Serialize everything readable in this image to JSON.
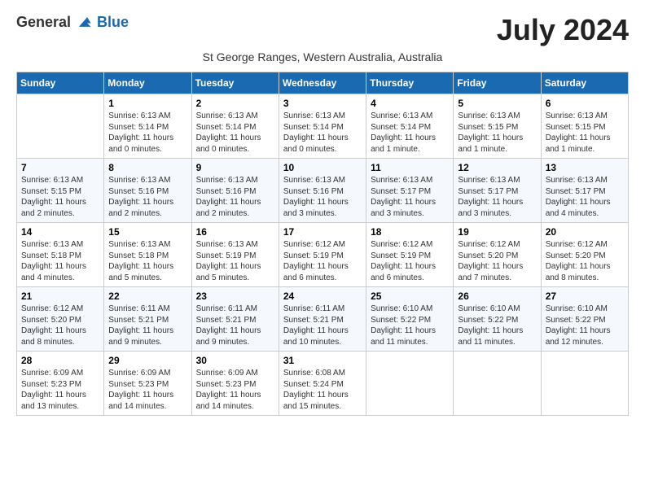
{
  "header": {
    "logo_general": "General",
    "logo_blue": "Blue",
    "month": "July 2024",
    "subtitle": "St George Ranges, Western Australia, Australia"
  },
  "days_of_week": [
    "Sunday",
    "Monday",
    "Tuesday",
    "Wednesday",
    "Thursday",
    "Friday",
    "Saturday"
  ],
  "weeks": [
    [
      {
        "day": "",
        "info": ""
      },
      {
        "day": "1",
        "info": "Sunrise: 6:13 AM\nSunset: 5:14 PM\nDaylight: 11 hours\nand 0 minutes."
      },
      {
        "day": "2",
        "info": "Sunrise: 6:13 AM\nSunset: 5:14 PM\nDaylight: 11 hours\nand 0 minutes."
      },
      {
        "day": "3",
        "info": "Sunrise: 6:13 AM\nSunset: 5:14 PM\nDaylight: 11 hours\nand 0 minutes."
      },
      {
        "day": "4",
        "info": "Sunrise: 6:13 AM\nSunset: 5:14 PM\nDaylight: 11 hours\nand 1 minute."
      },
      {
        "day": "5",
        "info": "Sunrise: 6:13 AM\nSunset: 5:15 PM\nDaylight: 11 hours\nand 1 minute."
      },
      {
        "day": "6",
        "info": "Sunrise: 6:13 AM\nSunset: 5:15 PM\nDaylight: 11 hours\nand 1 minute."
      }
    ],
    [
      {
        "day": "7",
        "info": "Sunrise: 6:13 AM\nSunset: 5:15 PM\nDaylight: 11 hours\nand 2 minutes."
      },
      {
        "day": "8",
        "info": "Sunrise: 6:13 AM\nSunset: 5:16 PM\nDaylight: 11 hours\nand 2 minutes."
      },
      {
        "day": "9",
        "info": "Sunrise: 6:13 AM\nSunset: 5:16 PM\nDaylight: 11 hours\nand 2 minutes."
      },
      {
        "day": "10",
        "info": "Sunrise: 6:13 AM\nSunset: 5:16 PM\nDaylight: 11 hours\nand 3 minutes."
      },
      {
        "day": "11",
        "info": "Sunrise: 6:13 AM\nSunset: 5:17 PM\nDaylight: 11 hours\nand 3 minutes."
      },
      {
        "day": "12",
        "info": "Sunrise: 6:13 AM\nSunset: 5:17 PM\nDaylight: 11 hours\nand 3 minutes."
      },
      {
        "day": "13",
        "info": "Sunrise: 6:13 AM\nSunset: 5:17 PM\nDaylight: 11 hours\nand 4 minutes."
      }
    ],
    [
      {
        "day": "14",
        "info": "Sunrise: 6:13 AM\nSunset: 5:18 PM\nDaylight: 11 hours\nand 4 minutes."
      },
      {
        "day": "15",
        "info": "Sunrise: 6:13 AM\nSunset: 5:18 PM\nDaylight: 11 hours\nand 5 minutes."
      },
      {
        "day": "16",
        "info": "Sunrise: 6:13 AM\nSunset: 5:19 PM\nDaylight: 11 hours\nand 5 minutes."
      },
      {
        "day": "17",
        "info": "Sunrise: 6:12 AM\nSunset: 5:19 PM\nDaylight: 11 hours\nand 6 minutes."
      },
      {
        "day": "18",
        "info": "Sunrise: 6:12 AM\nSunset: 5:19 PM\nDaylight: 11 hours\nand 6 minutes."
      },
      {
        "day": "19",
        "info": "Sunrise: 6:12 AM\nSunset: 5:20 PM\nDaylight: 11 hours\nand 7 minutes."
      },
      {
        "day": "20",
        "info": "Sunrise: 6:12 AM\nSunset: 5:20 PM\nDaylight: 11 hours\nand 8 minutes."
      }
    ],
    [
      {
        "day": "21",
        "info": "Sunrise: 6:12 AM\nSunset: 5:20 PM\nDaylight: 11 hours\nand 8 minutes."
      },
      {
        "day": "22",
        "info": "Sunrise: 6:11 AM\nSunset: 5:21 PM\nDaylight: 11 hours\nand 9 minutes."
      },
      {
        "day": "23",
        "info": "Sunrise: 6:11 AM\nSunset: 5:21 PM\nDaylight: 11 hours\nand 9 minutes."
      },
      {
        "day": "24",
        "info": "Sunrise: 6:11 AM\nSunset: 5:21 PM\nDaylight: 11 hours\nand 10 minutes."
      },
      {
        "day": "25",
        "info": "Sunrise: 6:10 AM\nSunset: 5:22 PM\nDaylight: 11 hours\nand 11 minutes."
      },
      {
        "day": "26",
        "info": "Sunrise: 6:10 AM\nSunset: 5:22 PM\nDaylight: 11 hours\nand 11 minutes."
      },
      {
        "day": "27",
        "info": "Sunrise: 6:10 AM\nSunset: 5:22 PM\nDaylight: 11 hours\nand 12 minutes."
      }
    ],
    [
      {
        "day": "28",
        "info": "Sunrise: 6:09 AM\nSunset: 5:23 PM\nDaylight: 11 hours\nand 13 minutes."
      },
      {
        "day": "29",
        "info": "Sunrise: 6:09 AM\nSunset: 5:23 PM\nDaylight: 11 hours\nand 14 minutes."
      },
      {
        "day": "30",
        "info": "Sunrise: 6:09 AM\nSunset: 5:23 PM\nDaylight: 11 hours\nand 14 minutes."
      },
      {
        "day": "31",
        "info": "Sunrise: 6:08 AM\nSunset: 5:24 PM\nDaylight: 11 hours\nand 15 minutes."
      },
      {
        "day": "",
        "info": ""
      },
      {
        "day": "",
        "info": ""
      },
      {
        "day": "",
        "info": ""
      }
    ]
  ]
}
